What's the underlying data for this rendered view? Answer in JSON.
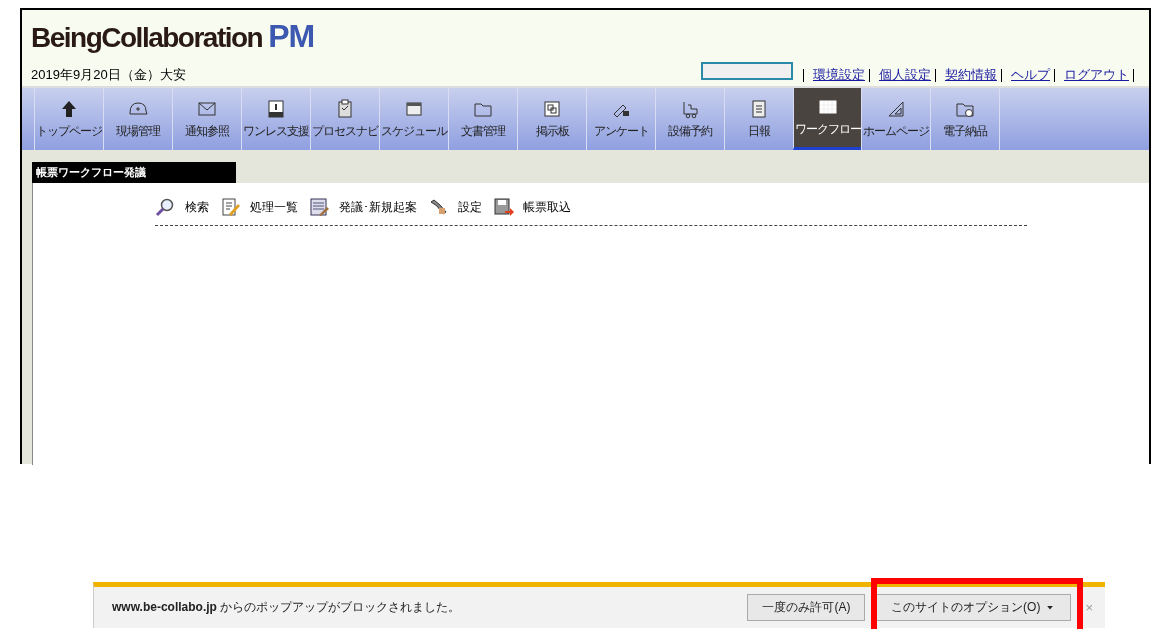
{
  "header": {
    "logo_main": "BeingCollaboration",
    "logo_suffix": "PM",
    "date": "2019年9月20日（金）大安",
    "links": [
      "環境設定",
      "個人設定",
      "契約情報",
      "ヘルプ",
      "ログアウト"
    ]
  },
  "nav": [
    {
      "label": "トップページ",
      "selected": false
    },
    {
      "label": "現場管理",
      "selected": false
    },
    {
      "label": "通知参照",
      "selected": false
    },
    {
      "label": "ワンレス支援",
      "selected": false
    },
    {
      "label": "プロセスナビ",
      "selected": false
    },
    {
      "label": "スケジュール",
      "selected": false
    },
    {
      "label": "文書管理",
      "selected": false
    },
    {
      "label": "掲示板",
      "selected": false
    },
    {
      "label": "アンケート",
      "selected": false
    },
    {
      "label": "設備予約",
      "selected": false
    },
    {
      "label": "日報",
      "selected": false
    },
    {
      "label": "ワークフロー",
      "selected": true
    },
    {
      "label": "ホームページ",
      "selected": false
    },
    {
      "label": "電子納品",
      "selected": false
    }
  ],
  "panel": {
    "title": "帳票ワークフロー発議",
    "tools": [
      "検索",
      "処理一覧",
      "発議･新規起案",
      "設定",
      "帳票取込"
    ]
  },
  "popup": {
    "message": "**www.be-collabo.jp** からのポップアップがブロックされました。",
    "buttons": [
      "一度のみ許可(A)",
      "このサイトのオプション(O)"
    ],
    "close": "×"
  }
}
